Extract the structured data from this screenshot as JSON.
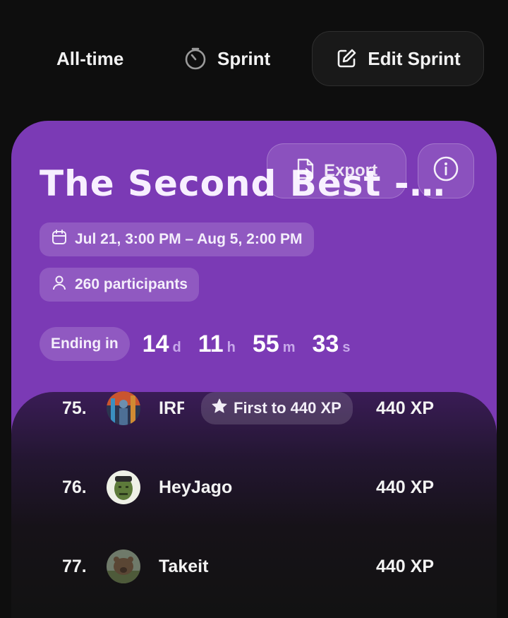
{
  "tabs": {
    "alltime_label": "All-time",
    "sprint_label": "Sprint",
    "edit_label": "Edit Sprint"
  },
  "sprint": {
    "title": "The Second Best -- Sprint",
    "export_label": "Export",
    "dates": "Jul 21, 3:00 PM – Aug 5, 2:00 PM",
    "participants": "260 participants",
    "ending_label": "Ending in",
    "countdown": {
      "days": "14",
      "days_suffix": "d",
      "hours": "11",
      "hours_suffix": "h",
      "minutes": "55",
      "minutes_suffix": "m",
      "seconds": "33",
      "seconds_suffix": "s"
    }
  },
  "leaderboard": {
    "rows": [
      {
        "rank": "75.",
        "name": "IRF",
        "xp": "440 XP",
        "badge": "First to 440 XP"
      },
      {
        "rank": "76.",
        "name": "HeyJago",
        "xp": "440 XP"
      },
      {
        "rank": "77.",
        "name": "Takeit",
        "xp": "440 XP"
      }
    ]
  },
  "colors": {
    "background": "#0e0e0e",
    "card": "#7b3ab5",
    "accent_suffix": "#c7a8ea"
  }
}
